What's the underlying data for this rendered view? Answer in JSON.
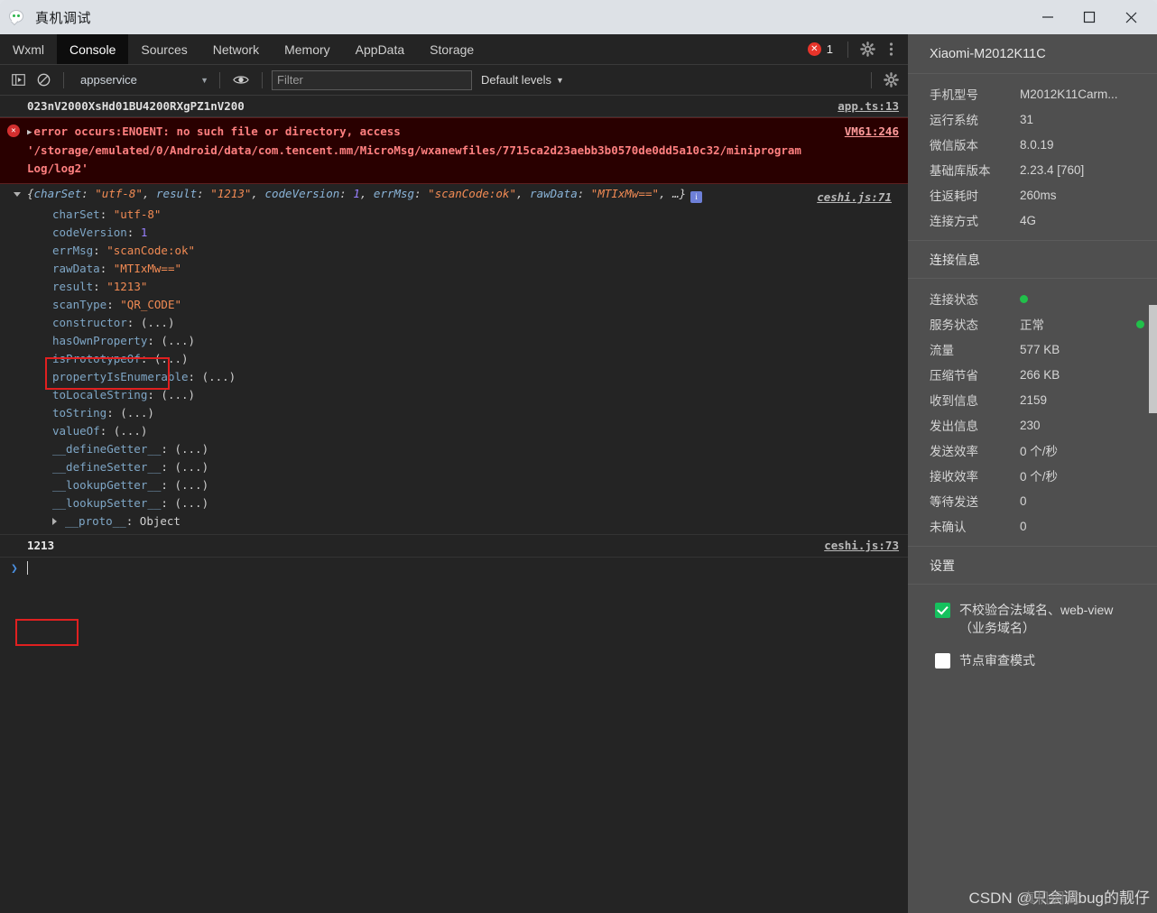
{
  "window": {
    "title": "真机调试",
    "icon": "wechat-bubble-icon",
    "minimize_label": "—",
    "maximize_label": "□",
    "close_label": "✕"
  },
  "tabs": [
    {
      "label": "Wxml",
      "active": false
    },
    {
      "label": "Console",
      "active": true
    },
    {
      "label": "Sources",
      "active": false
    },
    {
      "label": "Network",
      "active": false
    },
    {
      "label": "Memory",
      "active": false
    },
    {
      "label": "AppData",
      "active": false
    },
    {
      "label": "Storage",
      "active": false
    }
  ],
  "tabstrip_right": {
    "error_count": "1",
    "error_glyph": "✕",
    "settings_icon": "gear-icon",
    "more_icon": "more-vertical-icon"
  },
  "toolbar": {
    "sidebar_toggle_icon": "console-sidebar-icon",
    "clear_icon": "clear-console-icon",
    "context_value": "appservice",
    "context_caret": "▼",
    "eye_icon": "live-expression-eye-icon",
    "filter_placeholder": "Filter",
    "filter_value": "",
    "levels_label": "Default levels",
    "levels_caret": "▼",
    "settings_icon": "gear-icon"
  },
  "console": {
    "rows": [
      {
        "type": "log",
        "text": "023nV2000XsHd01BU4200RXgPZ1nV200",
        "source": "app.ts:13"
      },
      {
        "type": "error",
        "badge": "✕",
        "line1": "error occurs:ENOENT: no such file or directory, access",
        "line2": "'/storage/emulated/0/Android/data/com.tencent.mm/MicroMsg/wxanewfiles/7715ca2d23aebb3b0570de0dd5a10c32/miniprogram",
        "line3": "Log/log2'",
        "source": "VM61:246"
      }
    ],
    "object": {
      "preview": {
        "open_brace": "{",
        "close": ", …}",
        "pairs": [
          {
            "key": "charSet",
            "value": "\"utf-8\"",
            "kind": "string"
          },
          {
            "key": "result",
            "value": "\"1213\"",
            "kind": "string"
          },
          {
            "key": "codeVersion",
            "value": "1",
            "kind": "number"
          },
          {
            "key": "errMsg",
            "value": "\"scanCode:ok\"",
            "kind": "string"
          },
          {
            "key": "rawData",
            "value": "\"MTIxMw==\"",
            "kind": "string"
          }
        ]
      },
      "info_glyph": "i",
      "source": "ceshi.js:71",
      "properties": [
        {
          "name": "charSet",
          "value": "\"utf-8\"",
          "kind": "string"
        },
        {
          "name": "codeVersion",
          "value": "1",
          "kind": "number"
        },
        {
          "name": "errMsg",
          "value": "\"scanCode:ok\"",
          "kind": "string"
        },
        {
          "name": "rawData",
          "value": "\"MTIxMw==\"",
          "kind": "string"
        },
        {
          "name": "result",
          "value": "\"1213\"",
          "kind": "string"
        },
        {
          "name": "scanType",
          "value": "\"QR_CODE\"",
          "kind": "string"
        },
        {
          "name": "constructor",
          "value": "(...)",
          "kind": "dots"
        },
        {
          "name": "hasOwnProperty",
          "value": "(...)",
          "kind": "dots"
        },
        {
          "name": "isPrototypeOf",
          "value": "(...)",
          "kind": "dots"
        },
        {
          "name": "propertyIsEnumerable",
          "value": "(...)",
          "kind": "dots"
        },
        {
          "name": "toLocaleString",
          "value": "(...)",
          "kind": "dots"
        },
        {
          "name": "toString",
          "value": "(...)",
          "kind": "dots"
        },
        {
          "name": "valueOf",
          "value": "(...)",
          "kind": "dots"
        },
        {
          "name": "__defineGetter__",
          "value": "(...)",
          "kind": "dots"
        },
        {
          "name": "__defineSetter__",
          "value": "(...)",
          "kind": "dots"
        },
        {
          "name": "__lookupGetter__",
          "value": "(...)",
          "kind": "dots"
        },
        {
          "name": "__lookupSetter__",
          "value": "(...)",
          "kind": "dots"
        }
      ],
      "proto": {
        "name": "__proto__",
        "value": "Object"
      }
    },
    "result": {
      "text": "1213",
      "source": "ceshi.js:73"
    },
    "prompt": {
      "chevron": "❯",
      "value": ""
    }
  },
  "sidebar": {
    "device_title": "Xiaomi-M2012K11C",
    "device_info": [
      {
        "label": "手机型号",
        "value": "M2012K11Carm..."
      },
      {
        "label": "运行系统",
        "value": "31"
      },
      {
        "label": "微信版本",
        "value": "8.0.19"
      },
      {
        "label": "基础库版本",
        "value": "2.23.4 [760]"
      },
      {
        "label": "往返耗时",
        "value": "260ms"
      },
      {
        "label": "连接方式",
        "value": "4G"
      }
    ],
    "connection_header": "连接信息",
    "connection_info": [
      {
        "label": "连接状态",
        "value": "",
        "dot": "green-inline"
      },
      {
        "label": "服务状态",
        "value": "正常",
        "dot": "green-right"
      },
      {
        "label": "流量",
        "value": "577 KB"
      },
      {
        "label": "压缩节省",
        "value": "266 KB"
      },
      {
        "label": "收到信息",
        "value": "2159"
      },
      {
        "label": "发出信息",
        "value": "230"
      },
      {
        "label": "发送效率",
        "value": "0 个/秒"
      },
      {
        "label": "接收效率",
        "value": "0 个/秒"
      },
      {
        "label": "等待发送",
        "value": "0"
      },
      {
        "label": "未确认",
        "value": "0"
      }
    ],
    "settings_header": "设置",
    "settings": [
      {
        "label": "不校验合法域名、web-view（业务域名）",
        "checked": true
      },
      {
        "label": "节点审查模式",
        "checked": false
      }
    ]
  },
  "watermark": {
    "text": "CSDN @只会调bug的靓仔",
    "overlay": "真机调试"
  },
  "colors": {
    "accent_green": "#15c15e",
    "error_red": "#e8342a",
    "annotation_red": "#e02020",
    "string_orange": "#f28b54",
    "number_purple": "#9980ff",
    "key_blue": "#8ab4d8"
  }
}
